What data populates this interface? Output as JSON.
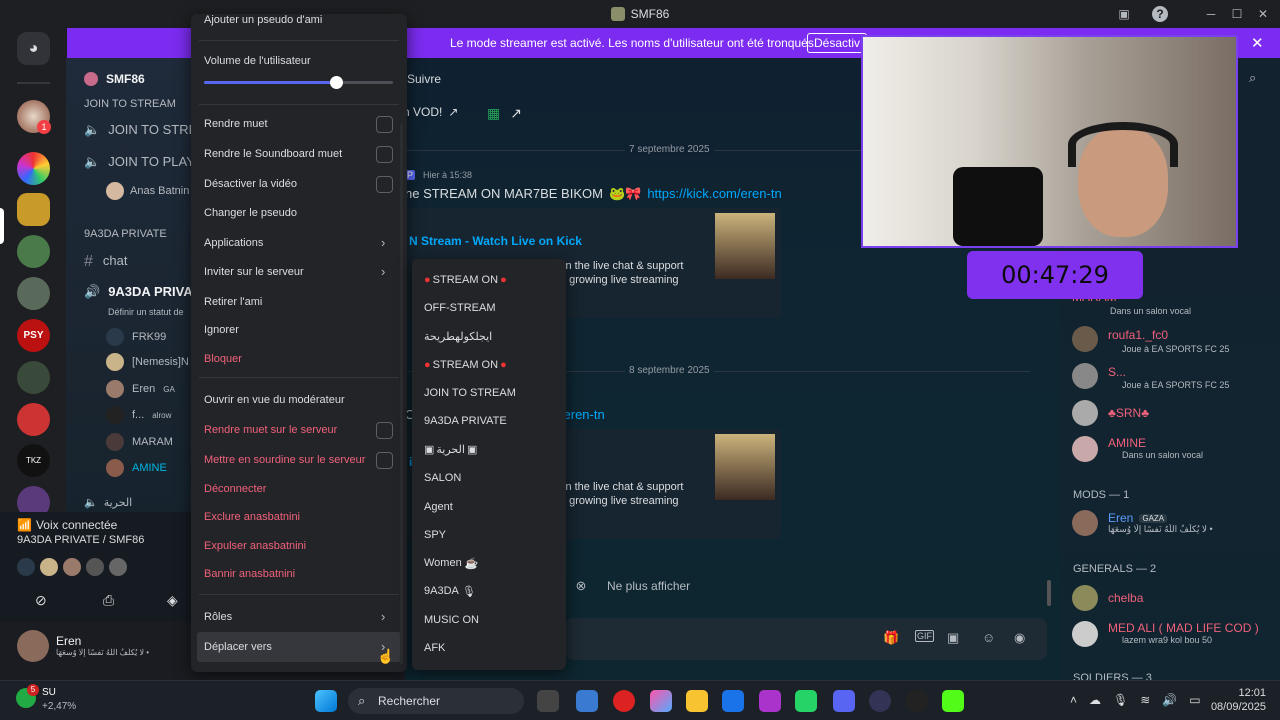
{
  "window": {
    "title": "SMF86"
  },
  "banner": {
    "text": "Le mode streamer est activé. Les noms d'utilisateur ont été tronqués.",
    "button": "Désactiv"
  },
  "sidebar": {
    "server_name": "SMF86",
    "category1": "JOIN TO STREAM",
    "channels": [
      "JOIN TO STRE",
      "JOIN TO PLAY"
    ],
    "voice_user1": "Anas Batnin",
    "category2": "9A3DA PRIVATE",
    "text_channel": "chat",
    "voice_channel": "9A3DA PRIVAT",
    "voice_status": "Définir un statut de",
    "voice_users": [
      "FRK99",
      "[Nemesis]N",
      "Eren",
      "f...",
      "MARAM",
      "AMINE"
    ],
    "badge_gaza": "GA",
    "badge_alrow": "alrow",
    "footer_category": "الحرية",
    "voice_connected": "Voix connectée",
    "voice_location": "9A3DA PRIVATE / SMF86",
    "user_name": "Eren",
    "user_status": "لا يُكلِّفُ اللَّهُ نَفسًا إِلَّا وُسعَهَا •"
  },
  "chat": {
    "follow_label": "Suivre",
    "vod_label": "h VOD!",
    "date1": "7 septembre 2025",
    "date2": "8 septembre 2025",
    "msg_time": "Hier à 15:38",
    "msg_prefix": "ne STREAM ON MAR7BE BIKOM",
    "msg_prefix2": "OM",
    "link": "https://kick.com/eren-tn",
    "embed_title": "N Stream - Watch Live on Kick",
    "embed_title2": "ick",
    "embed_desc1": "in the live chat & support",
    "embed_desc2": "t growing live streaming",
    "dismiss": "Ne plus afficher"
  },
  "context_menu": {
    "top_item": "Ajouter un pseudo d'ami",
    "volume_label": "Volume de l'utilisateur",
    "volume_level": 0.7,
    "items": [
      "Rendre muet",
      "Rendre le Soundboard muet",
      "Désactiver la vidéo",
      "Changer le pseudo",
      "Applications",
      "Inviter sur le serveur",
      "Retirer l'ami",
      "Ignorer",
      "Bloquer",
      "Ouvrir en vue du modérateur",
      "Rendre muet sur le serveur",
      "Mettre en sourdine sur le serveur",
      "Déconnecter",
      "Exclure anasbatnini",
      "Expulser anasbatnini",
      "Bannir anasbatnini",
      "Rôles",
      "Déplacer vers"
    ]
  },
  "submenu": {
    "items": [
      "STREAM ON",
      "OFF-STREAM",
      "ايجلكولهطريحة",
      "STREAM ON",
      "JOIN TO STREAM",
      "9A3DA PRIVATE",
      "الحرية",
      "SALON",
      "Agent",
      "SPY",
      "Women",
      "9A3DA",
      "MUSIC ON",
      "AFK"
    ]
  },
  "timer": {
    "value": "00:47:29"
  },
  "members": {
    "m1_name": "MARAM",
    "m1_status": "Dans un salon vocal",
    "m2_name": "roufa1._fc0",
    "m2_status": "Joue à EA SPORTS FC 25",
    "m3_name": "S...",
    "m3_status": "Joue à EA SPORTS FC 25",
    "m4_name": "♣SRN♣",
    "m5_name": "AMINE",
    "m5_status": "Dans un salon vocal",
    "mods_header": "MODS — 1",
    "mod_name": "Eren",
    "mod_badge": "GAZA",
    "mod_status": "لا يُكلِّفُ اللَّهُ نَفسًا إِلَّا وُسعَهَا •",
    "generals_header": "GENERALS — 2",
    "g1_name": "chelba",
    "g2_name": "MED ALI ( MAD LIFE COD )",
    "g2_status": "lazem wra9 kol bou 50",
    "soldiers_header": "SOLDIERS — 3"
  },
  "taskbar": {
    "stock_name": "SU",
    "stock_change": "+2,47%",
    "search_placeholder": "Rechercher",
    "time": "12:01",
    "date": "08/09/2025",
    "stock_badge": "5"
  },
  "colors": {
    "accent": "#7b2cf0",
    "danger": "#f0617a",
    "menu_bg": "#232428"
  }
}
